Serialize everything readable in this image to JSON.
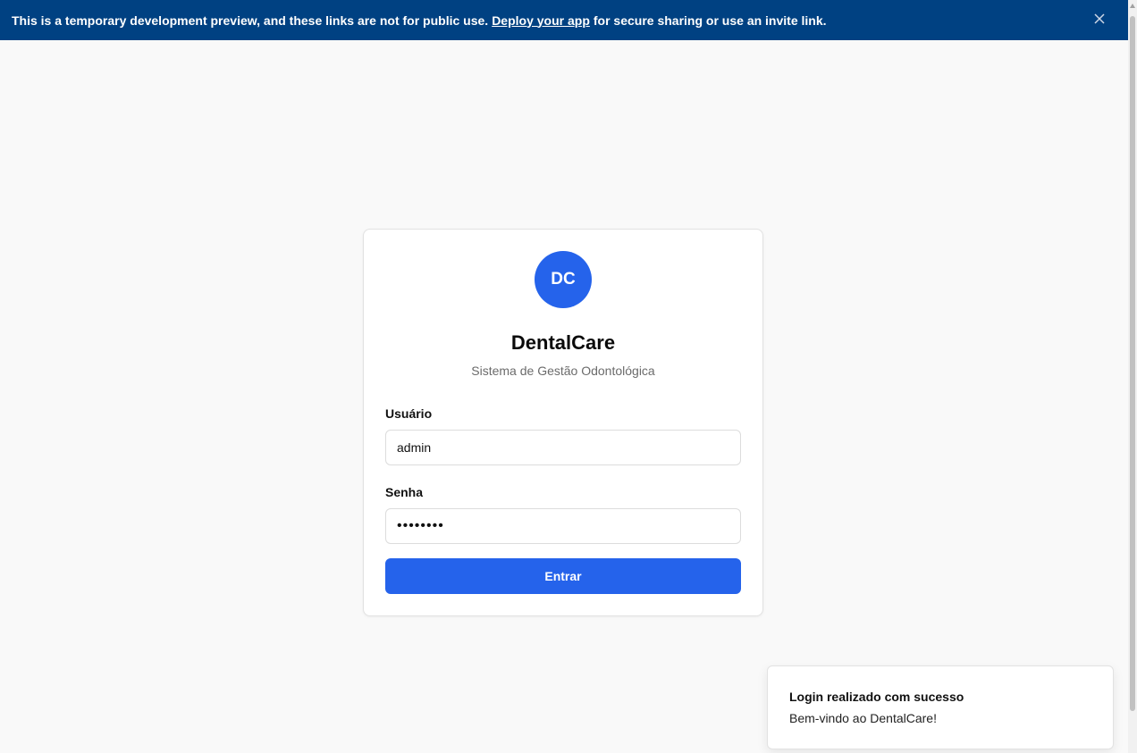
{
  "banner": {
    "text_before": "This is a temporary development preview, and these links are not for public use.",
    "link_text": "Deploy your app",
    "text_after": "for secure sharing or use an invite link.",
    "close_icon": "close-icon",
    "background": "#004182"
  },
  "login": {
    "logo_initials": "DC",
    "title": "DentalCare",
    "subtitle": "Sistema de Gestão Odontológica",
    "username_label": "Usuário",
    "username_value": "admin",
    "password_label": "Senha",
    "password_value": "••••••••",
    "submit_label": "Entrar",
    "accent": "#2563eb"
  },
  "toast": {
    "title": "Login realizado com sucesso",
    "description": "Bem-vindo ao DentalCare!"
  }
}
